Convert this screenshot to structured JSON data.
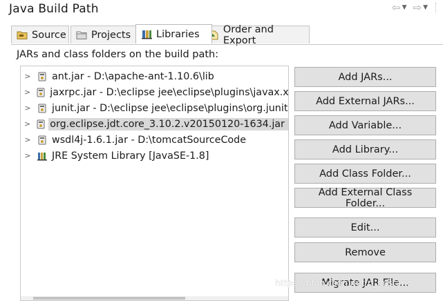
{
  "window": {
    "title": "Java Build Path"
  },
  "nav": {
    "back_icon": "back-arrow-icon",
    "forward_icon": "forward-arrow-icon"
  },
  "tabs": [
    {
      "label": "Source",
      "icon": "source-folder-icon",
      "active": false
    },
    {
      "label": "Projects",
      "icon": "projects-folder-icon",
      "active": false
    },
    {
      "label": "Libraries",
      "icon": "libraries-icon",
      "active": true
    },
    {
      "label": "Order and Export",
      "icon": "order-export-icon",
      "active": false
    }
  ],
  "libraries": {
    "heading": "JARs and class folders on the build path:",
    "entries": [
      {
        "label": "ant.jar - D:\\apache-ant-1.10.6\\lib",
        "icon": "jar-icon",
        "selected": false
      },
      {
        "label": "jaxrpc.jar - D:\\eclipse jee\\eclipse\\plugins\\javax.x",
        "icon": "jar-icon",
        "selected": false
      },
      {
        "label": "junit.jar - D:\\eclipse jee\\eclipse\\plugins\\org.junit",
        "icon": "jar-icon",
        "selected": false
      },
      {
        "label": "org.eclipse.jdt.core_3.10.2.v20150120-1634.jar -",
        "icon": "jar-icon",
        "selected": true
      },
      {
        "label": "wsdl4j-1.6.1.jar - D:\\tomcatSourceCode",
        "icon": "jar-icon",
        "selected": false
      },
      {
        "label": "JRE System Library [JavaSE-1.8]",
        "icon": "library-icon",
        "selected": false
      }
    ]
  },
  "buttons": {
    "add_jars": "Add JARs...",
    "add_external_jars": "Add External JARs...",
    "add_variable": "Add Variable...",
    "add_library": "Add Library...",
    "add_class_folder": "Add Class Folder...",
    "add_external_class_folder": "Add External Class Folder...",
    "edit": "Edit...",
    "remove": "Remove",
    "migrate_jar": "Migrate JAR File..."
  },
  "watermark": "https://blog.csdn.net/n_hostang"
}
